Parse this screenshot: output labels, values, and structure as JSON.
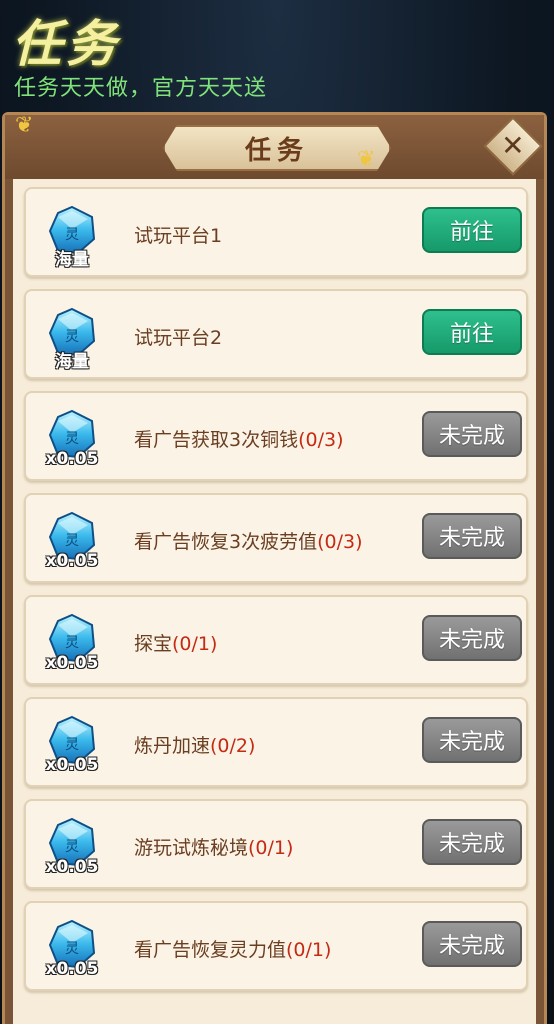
{
  "header": {
    "title": "任务",
    "subtitle": "任务天天做，官方天天送"
  },
  "panel": {
    "title": "任务",
    "close_icon": "close-icon"
  },
  "tasks": [
    {
      "reward_icon": "spirit-gem-icon",
      "reward_label": "海量",
      "name": "试玩平台1",
      "progress": "",
      "button": "前往",
      "status": "go"
    },
    {
      "reward_icon": "spirit-gem-icon",
      "reward_label": "海量",
      "name": "试玩平台2",
      "progress": "",
      "button": "前往",
      "status": "go"
    },
    {
      "reward_icon": "spirit-gem-icon",
      "reward_label": "x0.05",
      "name": "看广告获取3次铜钱",
      "progress": "(0/3)",
      "button": "未完成",
      "status": "todo"
    },
    {
      "reward_icon": "spirit-gem-icon",
      "reward_label": "x0.05",
      "name": "看广告恢复3次疲劳值",
      "progress": "(0/3)",
      "button": "未完成",
      "status": "todo"
    },
    {
      "reward_icon": "spirit-gem-icon",
      "reward_label": "x0.05",
      "name": "探宝",
      "progress": "(0/1)",
      "button": "未完成",
      "status": "todo"
    },
    {
      "reward_icon": "spirit-gem-icon",
      "reward_label": "x0.05",
      "name": "炼丹加速",
      "progress": "(0/2)",
      "button": "未完成",
      "status": "todo"
    },
    {
      "reward_icon": "spirit-gem-icon",
      "reward_label": "x0.05",
      "name": "游玩试炼秘境",
      "progress": "(0/1)",
      "button": "未完成",
      "status": "todo"
    },
    {
      "reward_icon": "spirit-gem-icon",
      "reward_label": "x0.05",
      "name": "看广告恢复灵力值",
      "progress": "(0/1)",
      "button": "未完成",
      "status": "todo"
    }
  ],
  "colors": {
    "go_button": "#169a6a",
    "todo_button": "#717171",
    "progress_text": "#c42a14",
    "task_text": "#6b3e22"
  }
}
